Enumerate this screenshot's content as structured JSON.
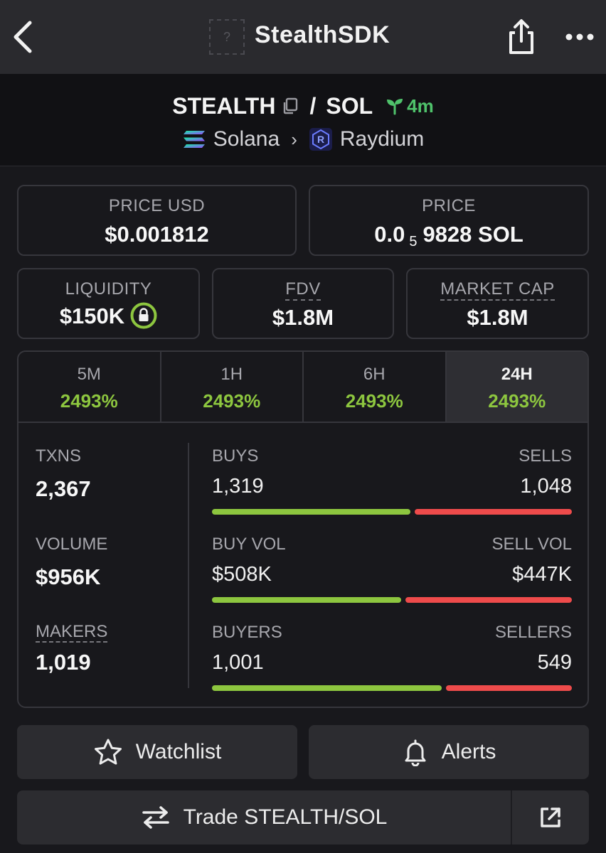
{
  "topbar": {
    "title": "StealthSDK",
    "logo_placeholder": "?",
    "icons": {
      "back": "chevron-left-icon",
      "share": "share-icon",
      "more": "more-dots-icon"
    }
  },
  "pair": {
    "base": "STEALTH",
    "separator": "/",
    "quote": "SOL",
    "age": "4m",
    "chain": "Solana",
    "dex": "Raydium"
  },
  "cards": {
    "price_usd": {
      "label": "PRICE USD",
      "value": "$0.001812"
    },
    "price": {
      "label": "PRICE",
      "value_prefix": "0.0",
      "value_zeros": "5",
      "value_suffix": "9828 SOL"
    },
    "liquidity": {
      "label": "LIQUIDITY",
      "value": "$150K"
    },
    "fdv": {
      "label": "FDV",
      "value": "$1.8M"
    },
    "market_cap": {
      "label": "MARKET CAP",
      "value": "$1.8M"
    }
  },
  "tabs": [
    {
      "label": "5M",
      "change": "2493%",
      "active": false
    },
    {
      "label": "1H",
      "change": "2493%",
      "active": false
    },
    {
      "label": "6H",
      "change": "2493%",
      "active": false
    },
    {
      "label": "24H",
      "change": "2493%",
      "active": true
    }
  ],
  "stats": {
    "txns": {
      "label": "TXNS",
      "value": "2,367"
    },
    "volume": {
      "label": "VOLUME",
      "value": "$956K"
    },
    "makers": {
      "label": "MAKERS",
      "value": "1,019"
    },
    "buys_sells": {
      "left_label": "BUYS",
      "left_value": "1,319",
      "right_label": "SELLS",
      "right_value": "1,048",
      "buy_fraction": 0.557
    },
    "vol": {
      "left_label": "BUY VOL",
      "left_value": "$508K",
      "right_label": "SELL VOL",
      "right_value": "$447K",
      "buy_fraction": 0.532
    },
    "buyers_sellers": {
      "left_label": "BUYERS",
      "left_value": "1,001",
      "right_label": "SELLERS",
      "right_value": "549",
      "buy_fraction": 0.646
    }
  },
  "buttons": {
    "watchlist": "Watchlist",
    "alerts": "Alerts",
    "trade": "Trade STEALTH/SOL"
  },
  "colors": {
    "green": "#8dc63f",
    "red": "#ee4b4b",
    "age_green": "#4fc26b"
  }
}
